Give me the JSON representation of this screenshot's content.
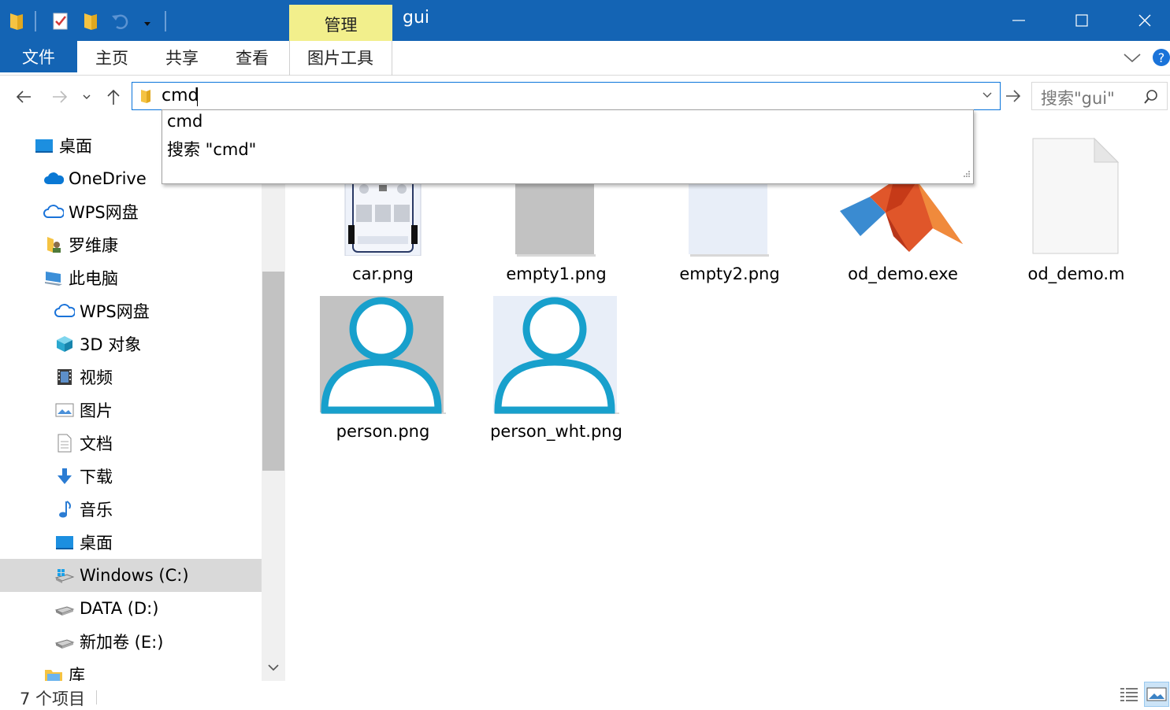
{
  "window": {
    "title": "gui",
    "context_tab_group": "管理"
  },
  "ribbon": {
    "tabs": [
      {
        "label": "文件"
      },
      {
        "label": "主页"
      },
      {
        "label": "共享"
      },
      {
        "label": "查看"
      },
      {
        "label": "图片工具"
      }
    ]
  },
  "address": {
    "value": "cmd",
    "suggestions": [
      "cmd",
      "搜索 \"cmd\""
    ]
  },
  "search": {
    "placeholder": "搜索\"gui\""
  },
  "nav": {
    "items": [
      {
        "label": "桌面",
        "icon": "desktop-icon"
      },
      {
        "label": "OneDrive",
        "icon": "onedrive-cloud-icon"
      },
      {
        "label": "WPS网盘",
        "icon": "cloud-icon"
      },
      {
        "label": "罗维康",
        "icon": "user-folder-icon"
      },
      {
        "label": "此电脑",
        "icon": "computer-icon"
      },
      {
        "label": "WPS网盘",
        "icon": "cloud-icon"
      },
      {
        "label": "3D 对象",
        "icon": "3d-objects-icon"
      },
      {
        "label": "视频",
        "icon": "video-icon"
      },
      {
        "label": "图片",
        "icon": "pictures-icon"
      },
      {
        "label": "文档",
        "icon": "documents-icon"
      },
      {
        "label": "下载",
        "icon": "download-icon"
      },
      {
        "label": "音乐",
        "icon": "music-icon"
      },
      {
        "label": "桌面",
        "icon": "desktop-icon"
      },
      {
        "label": "Windows (C:)",
        "icon": "windows-drive-icon",
        "selected": true
      },
      {
        "label": "DATA (D:)",
        "icon": "drive-icon"
      },
      {
        "label": "新加卷 (E:)",
        "icon": "drive-icon"
      },
      {
        "label": "库",
        "icon": "library-icon"
      }
    ]
  },
  "files": [
    {
      "name": "car.png",
      "icon": "car-image-thumbnail"
    },
    {
      "name": "empty1.png",
      "icon": "gray-image-thumbnail"
    },
    {
      "name": "empty2.png",
      "icon": "light-image-thumbnail"
    },
    {
      "name": "od_demo.exe",
      "icon": "matlab-icon"
    },
    {
      "name": "od_demo.m",
      "icon": "blank-file-icon"
    },
    {
      "name": "person.png",
      "icon": "person-gray-thumbnail"
    },
    {
      "name": "person_wht.png",
      "icon": "person-light-thumbnail"
    }
  ],
  "status": {
    "item_count": "7 个项目"
  },
  "colors": {
    "titlebar": "#1464b4",
    "context_tab": "#f2ef8c",
    "selection": "#d9d9d9",
    "accent_person": "#18a0cc"
  }
}
